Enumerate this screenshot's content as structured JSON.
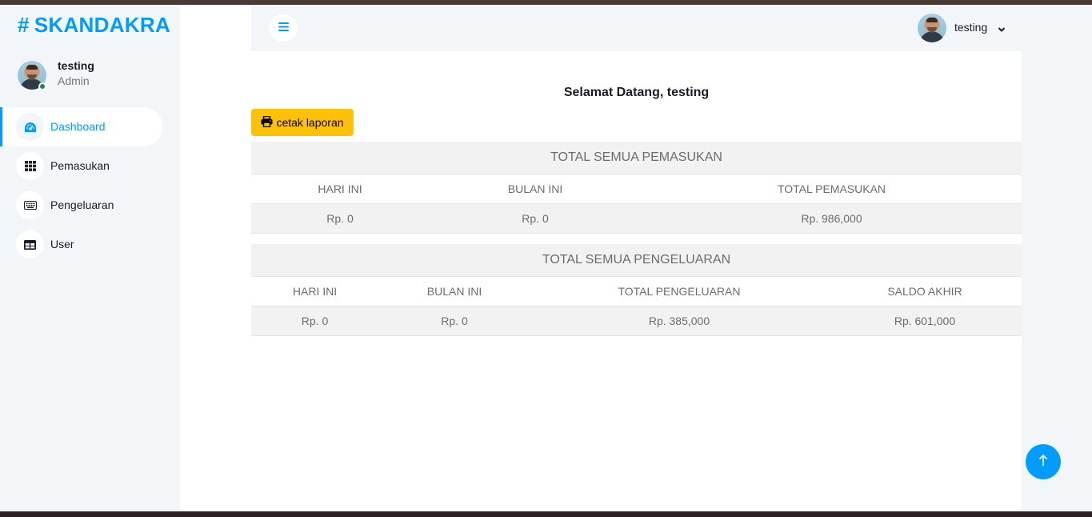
{
  "brand": {
    "hash": "#",
    "name": "SKANDAKRA",
    "color": "#009cff"
  },
  "profile": {
    "name": "testing",
    "role": "Admin",
    "status_color": "#198754"
  },
  "sidebar": {
    "items": [
      {
        "label": "Dashboard",
        "icon": "gauge-icon",
        "active": true
      },
      {
        "label": "Pemasukan",
        "icon": "grid-icon",
        "active": false
      },
      {
        "label": "Pengeluaran",
        "icon": "keyboard-icon",
        "active": false
      },
      {
        "label": "User",
        "icon": "table-icon",
        "active": false
      }
    ]
  },
  "header": {
    "toggle_icon": "bars-icon",
    "user_name": "testing",
    "dropdown_icon": "chevron-down-icon"
  },
  "main": {
    "welcome": "Selamat Datang, testing",
    "print_button": "cetak laporan",
    "print_icon": "printer-icon",
    "accent_color": "#ffc107"
  },
  "income": {
    "title": "TOTAL SEMUA PEMASUKAN",
    "headers": [
      "HARI INI",
      "BULAN INI",
      "TOTAL PEMASUKAN"
    ],
    "values": [
      "Rp. 0",
      "Rp. 0",
      "Rp. 986,000"
    ]
  },
  "expense": {
    "title": "TOTAL SEMUA PENGELUARAN",
    "headers": [
      "HARI INI",
      "BULAN INI",
      "TOTAL PENGELUARAN",
      "SALDO AKHIR"
    ],
    "values": [
      "Rp. 0",
      "Rp. 0",
      "Rp. 385,000",
      "Rp. 601,000"
    ]
  },
  "scroll_top_icon": "arrow-up-icon"
}
